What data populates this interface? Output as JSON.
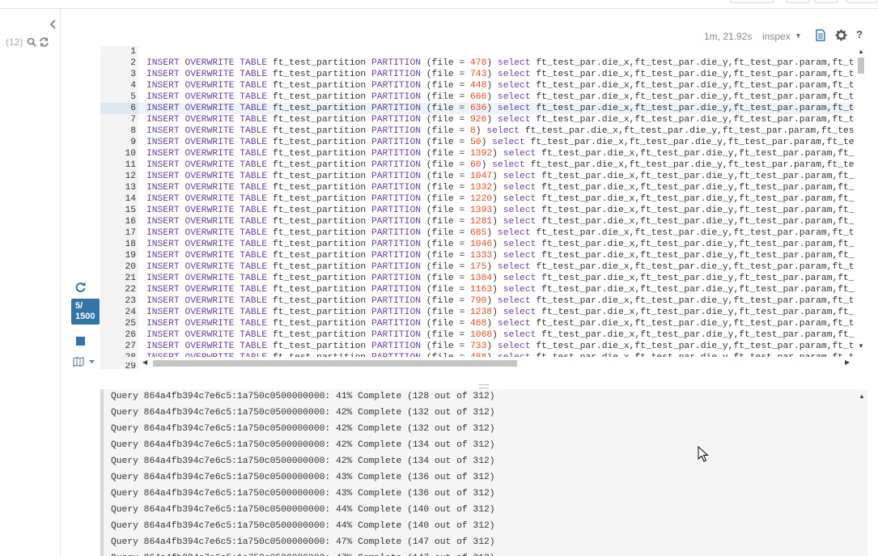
{
  "sidebar": {
    "count_text": "(12)",
    "icons": [
      "collapse-chevron-icon",
      "search-icon",
      "refresh-icon"
    ]
  },
  "editor_header": {
    "execution_time": "1m, 21.92s",
    "database": "inspex",
    "icons": [
      "document-icon",
      "gear-icon",
      "help-icon"
    ],
    "help_label": "?"
  },
  "query_controls": {
    "progress_current": "5/",
    "progress_total": "1500",
    "icons": [
      "rerun-icon",
      "stop-icon",
      "map-icon"
    ]
  },
  "editor": {
    "statement_prefix": "INSERT OVERWRITE TABLE ft_test_partition PARTITION",
    "select_tail": " select ft_test_par.die_x,ft_test_par.die_y,ft_test_par.param,ft_test_",
    "active_line": 6,
    "lines": [
      {
        "n": "1",
        "text": ""
      },
      {
        "n": "2",
        "file": "478"
      },
      {
        "n": "3",
        "file": "743"
      },
      {
        "n": "4",
        "file": "448"
      },
      {
        "n": "5",
        "file": "666"
      },
      {
        "n": "6",
        "file": "636"
      },
      {
        "n": "7",
        "file": "926"
      },
      {
        "n": "8",
        "file": "8"
      },
      {
        "n": "9",
        "file": "50"
      },
      {
        "n": "10",
        "file": "1392"
      },
      {
        "n": "11",
        "file": "60"
      },
      {
        "n": "12",
        "file": "1047"
      },
      {
        "n": "13",
        "file": "1332"
      },
      {
        "n": "14",
        "file": "1220"
      },
      {
        "n": "15",
        "file": "1393"
      },
      {
        "n": "16",
        "file": "1281"
      },
      {
        "n": "17",
        "file": "685"
      },
      {
        "n": "18",
        "file": "1046"
      },
      {
        "n": "19",
        "file": "1333"
      },
      {
        "n": "20",
        "file": "175"
      },
      {
        "n": "21",
        "file": "1304"
      },
      {
        "n": "22",
        "file": "1163"
      },
      {
        "n": "23",
        "file": "790"
      },
      {
        "n": "24",
        "file": "1238"
      },
      {
        "n": "25",
        "file": "468"
      },
      {
        "n": "26",
        "file": "1068"
      },
      {
        "n": "27",
        "file": "733"
      },
      {
        "n": "28",
        "file": "488"
      }
    ],
    "last_visible_line_number": "29"
  },
  "log": {
    "lines": [
      "Query 864a4fb394c7e6c5:1a750c0500000000: 41% Complete (128 out of 312)",
      "Query 864a4fb394c7e6c5:1a750c0500000000: 42% Complete (132 out of 312)",
      "Query 864a4fb394c7e6c5:1a750c0500000000: 42% Complete (132 out of 312)",
      "Query 864a4fb394c7e6c5:1a750c0500000000: 42% Complete (134 out of 312)",
      "Query 864a4fb394c7e6c5:1a750c0500000000: 42% Complete (134 out of 312)",
      "Query 864a4fb394c7e6c5:1a750c0500000000: 43% Complete (136 out of 312)",
      "Query 864a4fb394c7e6c5:1a750c0500000000: 43% Complete (136 out of 312)",
      "Query 864a4fb394c7e6c5:1a750c0500000000: 44% Complete (140 out of 312)",
      "Query 864a4fb394c7e6c5:1a750c0500000000: 44% Complete (140 out of 312)",
      "Query 864a4fb394c7e6c5:1a750c0500000000: 47% Complete (147 out of 312)",
      "Query 864a4fb394c7e6c5:1a750c0500000000: 47% Complete (147 out of 312)"
    ]
  },
  "colors": {
    "accent": "#3074a8",
    "keyword": "#6b3f9c",
    "number": "#e24a1c"
  }
}
